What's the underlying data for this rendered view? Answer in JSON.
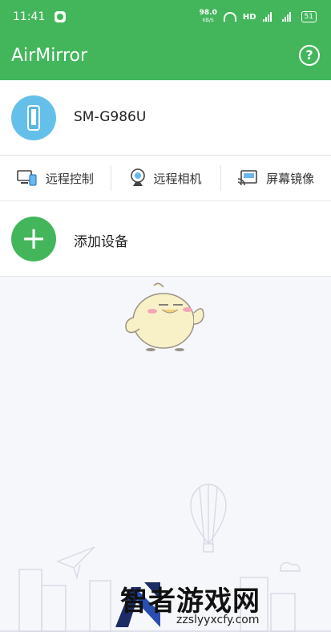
{
  "status_bar": {
    "time": "11:41",
    "net_speed": "98.0",
    "net_unit": "KB/S",
    "network": "HD",
    "battery": "51"
  },
  "appbar": {
    "title": "AirMirror",
    "help_icon": "?"
  },
  "device": {
    "name": "SM-G986U"
  },
  "actions": [
    {
      "label": "远程控制",
      "icon": "remote-control-icon"
    },
    {
      "label": "远程相机",
      "icon": "camera-icon"
    },
    {
      "label": "屏幕镜像",
      "icon": "screen-mirror-icon"
    }
  ],
  "add_device": {
    "label": "添加设备",
    "icon": "+"
  },
  "watermark": {
    "brand": "智者游戏网",
    "url": "zzslyyxcfy.com"
  },
  "colors": {
    "primary": "#43b65c",
    "avatar": "#64c0ea",
    "background": "#f6f7fb"
  }
}
